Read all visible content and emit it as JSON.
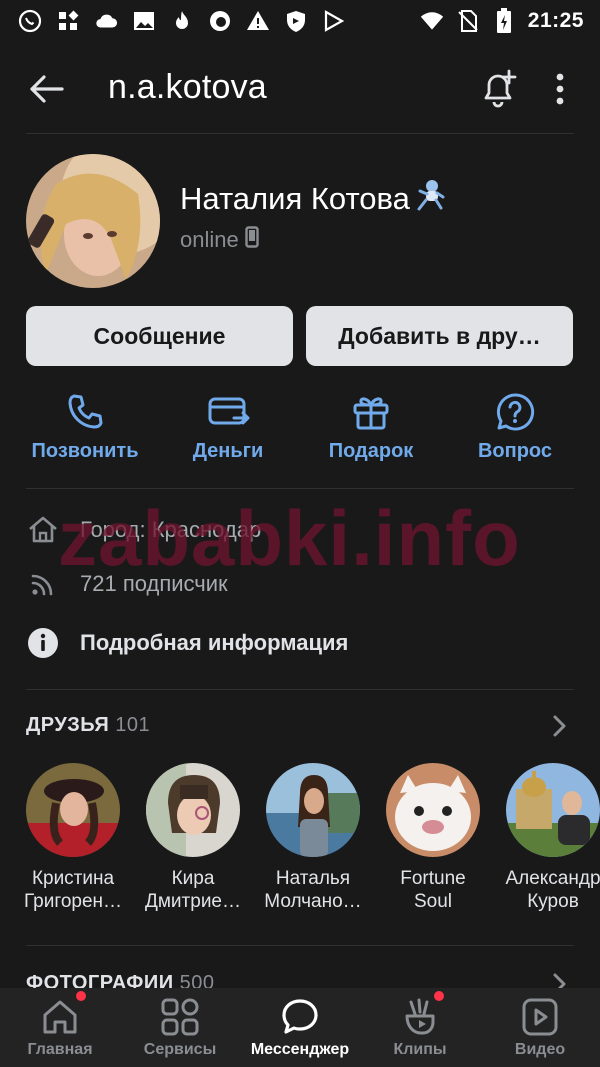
{
  "status_bar": {
    "time": "21:25",
    "icons": [
      "viber-icon",
      "apps-icon",
      "cloud-icon",
      "image-icon",
      "tinder-icon",
      "firefox-icon",
      "warning-icon",
      "shield-icon",
      "play-protect-icon",
      "wifi-icon",
      "no-sim-icon",
      "battery-charging-icon"
    ]
  },
  "header": {
    "username": "n.a.kotova",
    "icons": [
      "back-arrow-icon",
      "add-notification-icon",
      "more-vertical-icon"
    ]
  },
  "profile": {
    "full_name": "Наталия Котова",
    "status_emoji": "🧑‍🚀",
    "status": "online",
    "status_icon": "mobile-phone-icon"
  },
  "buttons": {
    "message": "Сообщение",
    "add_friend": "Добавить в дру…"
  },
  "actions": [
    {
      "label": "Позвонить",
      "icon": "phone-icon"
    },
    {
      "label": "Деньги",
      "icon": "money-transfer-icon"
    },
    {
      "label": "Подарок",
      "icon": "gift-icon"
    },
    {
      "label": "Вопрос",
      "icon": "question-bubble-icon"
    }
  ],
  "info": {
    "city": "Город: Краснодар",
    "followers": "721 подписчик",
    "details": "Подробная информация"
  },
  "friends": {
    "title": "ДРУЗЬЯ",
    "count": "101",
    "items": [
      {
        "first": "Кристина",
        "last": "Григорен…"
      },
      {
        "first": "Кира",
        "last": "Дмитрие…"
      },
      {
        "first": "Наталья",
        "last": "Молчано…"
      },
      {
        "first": "Fortune",
        "last": "Soul"
      },
      {
        "first": "Александр",
        "last": "Куров"
      }
    ]
  },
  "photos": {
    "title": "ФОТОГРАФИИ",
    "count": "500"
  },
  "watermark": "zababki.info",
  "bottom_nav": [
    {
      "label": "Главная",
      "icon": "home-icon",
      "badge": true
    },
    {
      "label": "Сервисы",
      "icon": "services-grid-icon",
      "badge": false
    },
    {
      "label": "Мессенджер",
      "icon": "messenger-bubble-icon",
      "badge": false,
      "active": true
    },
    {
      "label": "Клипы",
      "icon": "clips-icon",
      "badge": true
    },
    {
      "label": "Видео",
      "icon": "video-icon",
      "badge": false
    }
  ],
  "colors": {
    "background": "#19191a",
    "accent": "#71aaeb",
    "badge": "#ff3347",
    "button": "#e1e3e6"
  }
}
